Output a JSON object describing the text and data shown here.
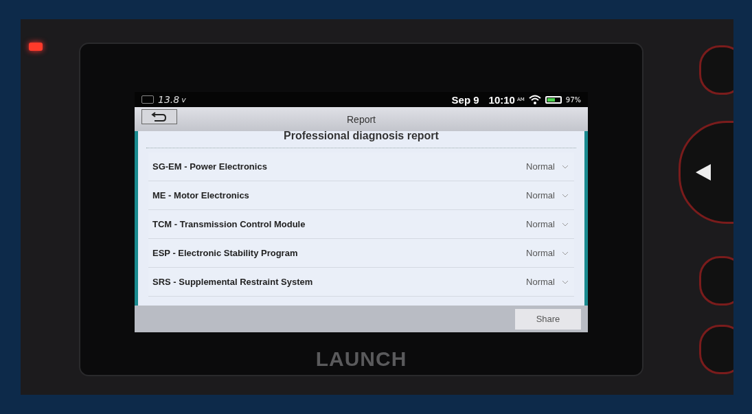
{
  "status_bar": {
    "voltage": "13.8",
    "voltage_unit": "v",
    "date": "Sep 9",
    "time": "10:10",
    "meridiem": "AM",
    "battery": "97%"
  },
  "title_bar": {
    "title": "Report"
  },
  "report": {
    "heading": "Professional diagnosis report",
    "rows": [
      {
        "system": "SG-EM - Power Electronics",
        "status": "Normal",
        "expanded": false
      },
      {
        "system": "ME - Motor Electronics",
        "status": "Normal",
        "expanded": false
      },
      {
        "system": "TCM - Transmission Control Module",
        "status": "Normal",
        "expanded": false
      },
      {
        "system": "ESP - Electronic Stability Program",
        "status": "Normal",
        "expanded": false
      },
      {
        "system": "SRS - Supplemental Restraint System",
        "status": "Normal",
        "expanded": false
      }
    ]
  },
  "footer": {
    "buttons": [
      "Share"
    ]
  },
  "device": {
    "brand": "LAUNCH"
  }
}
